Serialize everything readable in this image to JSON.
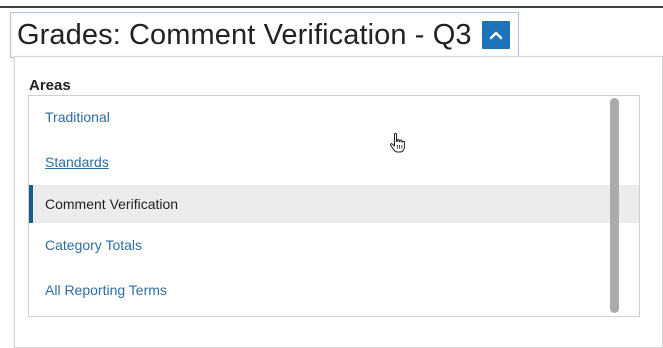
{
  "header": {
    "title": "Grades: Comment Verification - Q3",
    "toggle_icon": "chevron-up-icon",
    "accent_color": "#1d74b8"
  },
  "dropdown": {
    "section_label": "Areas",
    "items": [
      {
        "label": "Traditional",
        "state": "link"
      },
      {
        "label": "Standards",
        "state": "hover-underline"
      },
      {
        "label": "Comment Verification",
        "state": "selected"
      },
      {
        "label": "Category Totals",
        "state": "link"
      },
      {
        "label": "All Reporting Terms",
        "state": "link"
      }
    ],
    "link_color": "#2e6da4",
    "selected_bar_color": "#1a5d8c"
  },
  "cursor": {
    "icon": "hand-pointer-icon"
  }
}
